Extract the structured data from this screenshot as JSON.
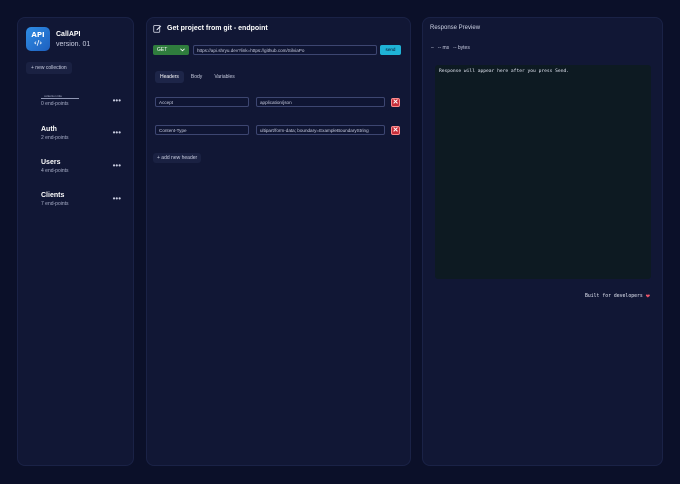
{
  "sidebar": {
    "app_name": "CallAPI",
    "version": "version. 01",
    "logo_text_top": "API",
    "logo_text_bottom": "‹/›",
    "new_collection_label": "+ new collection",
    "rename_placeholder": "collection title",
    "collections": [
      {
        "name": "",
        "count": "0 end-points"
      },
      {
        "name": "Auth",
        "count": "2 end-points"
      },
      {
        "name": "Users",
        "count": "4 end-points"
      },
      {
        "name": "Clients",
        "count": "7 end-points"
      }
    ],
    "menu_glyph": "•••"
  },
  "editor": {
    "title": "Get project from git  -  endpoint",
    "method": "GET",
    "url": "https://api.shryu.dev?link=https://github.com/SilviaPo",
    "send_label": "send",
    "tabs": [
      "Headers",
      "Body",
      "Variables"
    ],
    "active_tab": "Headers",
    "headers": [
      {
        "key": "Accept",
        "value": "application/json"
      },
      {
        "key": "Content-Type",
        "value": "ultipart/form-data; boundary=ExampleBoundaryString"
      }
    ],
    "delete_glyph": "✕",
    "add_header_label": "+ add new header"
  },
  "response": {
    "title": "Response Preview",
    "status": "–",
    "time": "-- ms",
    "size": "-- bytes",
    "placeholder": "Response will appear here after you press Send.",
    "footer": "Built for developers",
    "heart_glyph": "❤"
  },
  "colors": {
    "background": "#0b1029",
    "panel": "#111735",
    "method_get": "#2f7d3d",
    "send": "#1fb3d6",
    "delete": "#c62e3a",
    "logo": "#2f8de4"
  }
}
